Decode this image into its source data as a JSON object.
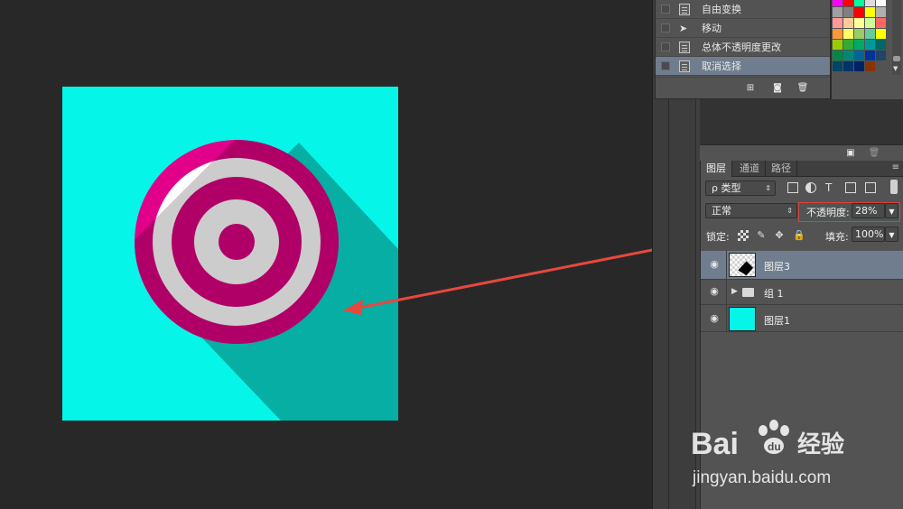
{
  "history": {
    "items": [
      {
        "label": "自由变换",
        "icon": "history-doc-icon"
      },
      {
        "label": "移动",
        "icon": "move-tool-icon"
      },
      {
        "label": "总体不透明度更改",
        "icon": "history-doc-icon"
      },
      {
        "label": "取消选择",
        "icon": "history-doc-icon",
        "selected": true
      }
    ],
    "footer_icons": [
      "new-document-from-state-icon",
      "camera-snapshot-icon",
      "trash-icon"
    ]
  },
  "swatches": {
    "colors": [
      "#ff00ff",
      "#ff0000",
      "#00ff99",
      "#dddddd",
      "#ffffff",
      "#a0a0a0",
      "#808080",
      "#ff0000",
      "#ffff00",
      "#b0b0b0",
      "#ff9999",
      "#ffcc99",
      "#ffff99",
      "#ccff99",
      "#ff6666",
      "#ff9933",
      "#ffff66",
      "#99cc66",
      "#66cc99",
      "#ffff00",
      "#99cc00",
      "#33aa33",
      "#00aa66",
      "#009999",
      "#006666",
      "#008844",
      "#008877",
      "#006699",
      "#003399",
      "#224466",
      "#004466",
      "#003366",
      "#002266",
      "#883300"
    ]
  },
  "layers": {
    "tabs": [
      "图层",
      "通道",
      "路径"
    ],
    "active_tab": "图层",
    "filter_label": "ρ 类型",
    "blend_mode": "正常",
    "opacity_label": "不透明度:",
    "opacity_value": "28%",
    "lock_label": "锁定:",
    "fill_label": "填充:",
    "fill_value": "100%",
    "rows": [
      {
        "name": "图层3",
        "selected": true
      },
      {
        "name": "组 1",
        "selected": false
      },
      {
        "name": "图层1",
        "selected": false
      }
    ]
  },
  "canvas": {
    "background_color": "#05f5e8",
    "target_colors": [
      "#e2008b",
      "#ffffff",
      "#cccccc",
      "#b00068"
    ]
  },
  "watermark": {
    "brand": "Bai",
    "brand_suffix": "经验",
    "url": "jingyan.baidu.com"
  },
  "colors": {
    "annotation_red": "#e8473f",
    "selection_blue": "#6f7d8e",
    "panel_gray": "#535353"
  }
}
